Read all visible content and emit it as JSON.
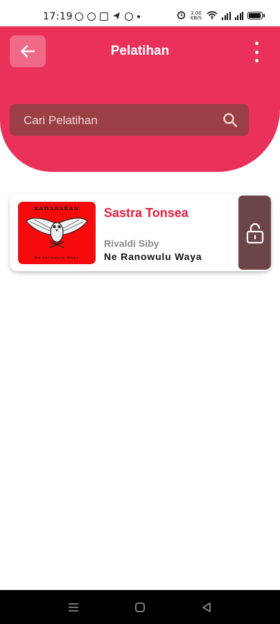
{
  "status_bar": {
    "time": "17:19",
    "net_speed_value": "2.00",
    "net_speed_unit": "KB/S"
  },
  "header": {
    "title": "Pelatihan",
    "background_color": "#ea3159"
  },
  "search": {
    "placeholder": "Cari Pelatihan"
  },
  "courses": [
    {
      "title": "Sastra Tonsea",
      "instructor": "Rivaldi Siby",
      "subtitle": "Ne Ranowulu Waya",
      "thumbnail_top_text": "KAWASARAN",
      "thumbnail_bottom_text": "Ne Ranowulu Waya",
      "lock_icon": "unlock-icon"
    }
  ],
  "icons": {
    "back": "arrow-left-icon",
    "menu": "more-vertical-icon",
    "search": "search-icon",
    "nav_recent": "menu-icon",
    "nav_home": "square-icon",
    "nav_back": "triangle-back-icon"
  }
}
